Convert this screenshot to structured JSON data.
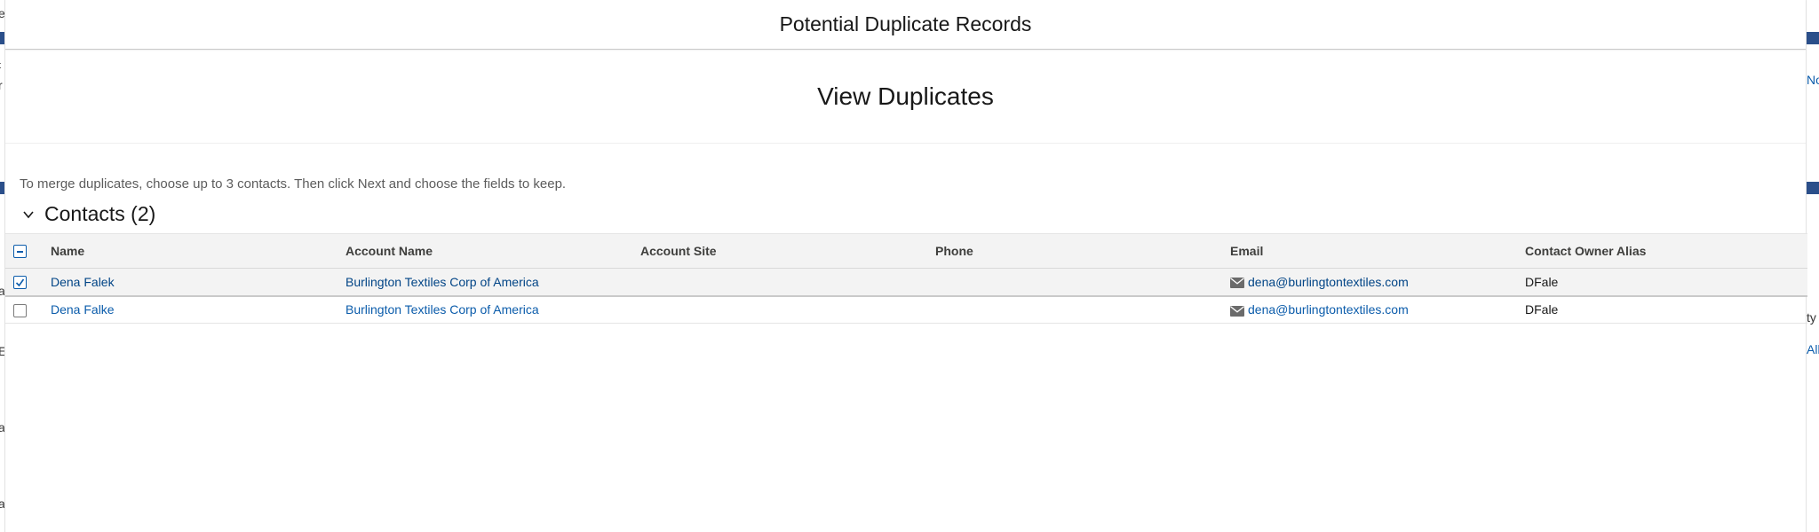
{
  "modal": {
    "title": "Potential Duplicate Records",
    "section_title": "View Duplicates",
    "instructions": "To merge duplicates, choose up to 3 contacts. Then click Next and choose the fields to keep.",
    "group_title": "Contacts (2)"
  },
  "table": {
    "columns": [
      "Name",
      "Account Name",
      "Account Site",
      "Phone",
      "Email",
      "Contact Owner Alias"
    ],
    "rows": [
      {
        "selected": true,
        "name": "Dena Falek",
        "account": "Burlington Textiles Corp of America",
        "site": "",
        "phone": "",
        "email": "dena@burlingtontextiles.com",
        "owner": "DFale"
      },
      {
        "selected": false,
        "name": "Dena Falke",
        "account": "Burlington Textiles Corp of America",
        "site": "",
        "phone": "",
        "email": "dena@burlingtontextiles.com",
        "owner": "DFale"
      }
    ]
  },
  "background_fragments": {
    "left": [
      "e",
      "t",
      "r",
      "a",
      "E",
      "a",
      "a"
    ],
    "right": [
      "No",
      "ty",
      "All"
    ]
  },
  "colors": {
    "link": "#0b5cab",
    "accent": "#2b4f8a",
    "header_bg": "#f3f3f3"
  },
  "icons": [
    "chevron-down-icon",
    "mail-icon",
    "checkmark-icon"
  ]
}
